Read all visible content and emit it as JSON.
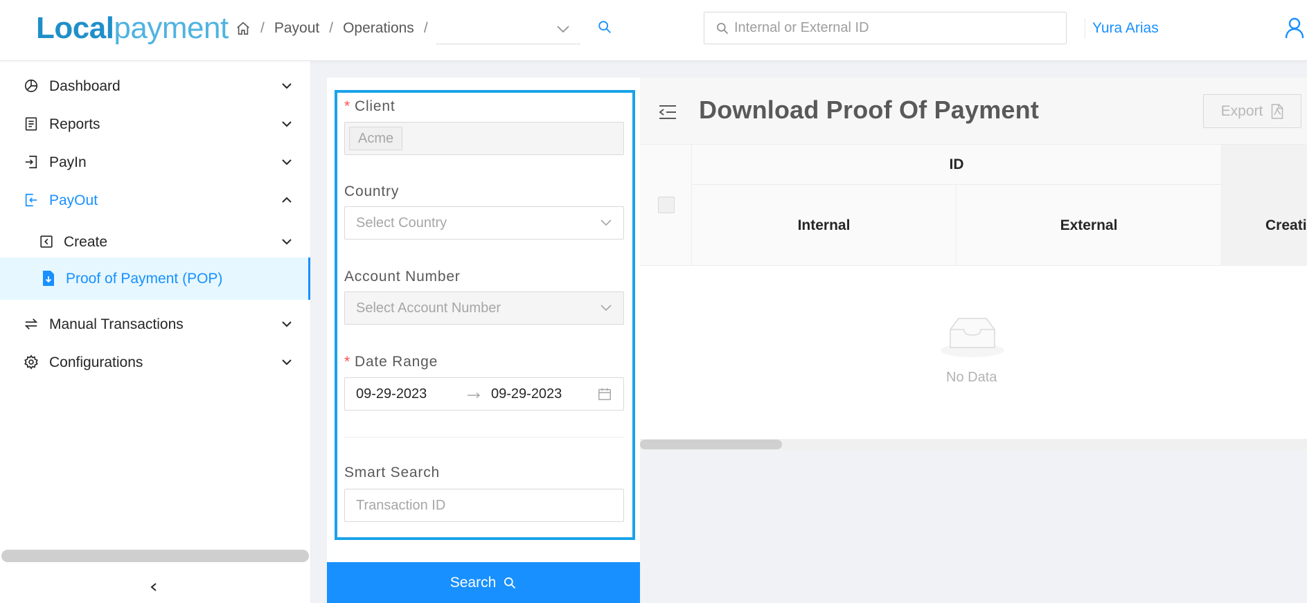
{
  "header": {
    "logo_part1": "Local",
    "logo_part2": "payment",
    "breadcrumb": [
      "Payout",
      "Operations"
    ],
    "breadcrumb_separator": "/",
    "search_placeholder": "Internal or External ID",
    "user_name": "Yura Arias"
  },
  "sidebar": {
    "items": [
      {
        "label": "Dashboard",
        "icon": "pie-chart-icon"
      },
      {
        "label": "Reports",
        "icon": "report-icon"
      },
      {
        "label": "PayIn",
        "icon": "login-icon"
      },
      {
        "label": "PayOut",
        "icon": "logout-icon"
      },
      {
        "label": "Create",
        "icon": "create-icon"
      },
      {
        "label": "Proof of Payment (POP)",
        "icon": "file-download-icon"
      },
      {
        "label": "Manual Transactions",
        "icon": "swap-icon"
      },
      {
        "label": "Configurations",
        "icon": "gear-icon"
      }
    ]
  },
  "filters": {
    "client_label": "Client",
    "client_value": "Acme",
    "country_label": "Country",
    "country_placeholder": "Select Country",
    "account_label": "Account Number",
    "account_placeholder": "Select Account Number",
    "date_label": "Date Range",
    "date_start": "09-29-2023",
    "date_end": "09-29-2023",
    "smart_search_label": "Smart Search",
    "smart_search_placeholder": "Transaction ID",
    "search_button": "Search"
  },
  "content": {
    "title": "Download Proof Of Payment",
    "export_label": "Export",
    "table": {
      "group_header": "ID",
      "columns": [
        "Internal",
        "External",
        "Creatio"
      ]
    },
    "empty_text": "No Data"
  },
  "colors": {
    "primary": "#1890ff",
    "highlight_border": "#1aa3e8",
    "required": "#ff4d4f"
  }
}
